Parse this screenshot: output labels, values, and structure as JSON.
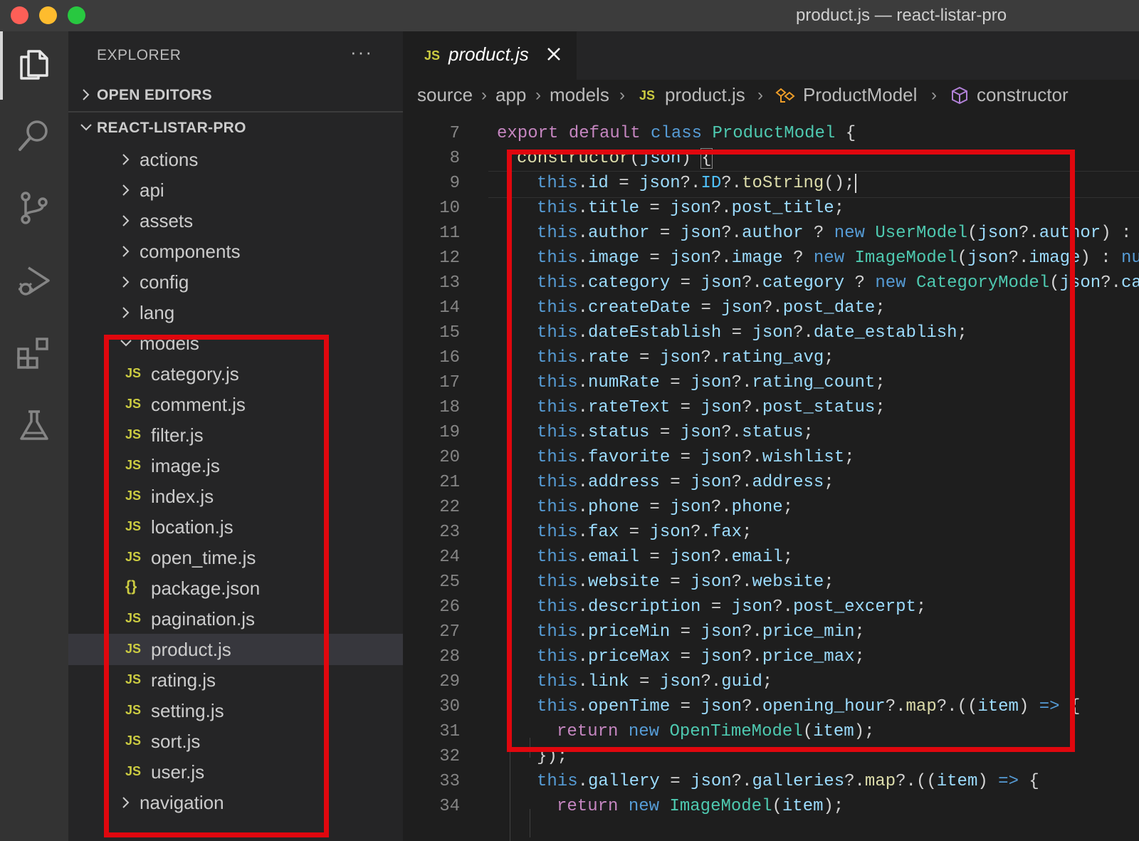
{
  "window": {
    "title": "product.js — react-listar-pro"
  },
  "activity_bar": {
    "icons": [
      "files-icon",
      "search-icon",
      "source-control-icon",
      "run-debug-icon",
      "extensions-icon",
      "testing-icon"
    ]
  },
  "sidebar": {
    "title": "EXPLORER",
    "more": "···",
    "open_editors": "OPEN EDITORS",
    "project": "REACT-LISTAR-PRO",
    "folders_top": [
      "actions",
      "api",
      "assets",
      "components",
      "config",
      "lang"
    ],
    "models_folder": "models",
    "model_files": [
      {
        "name": "category.js",
        "icon": "JS"
      },
      {
        "name": "comment.js",
        "icon": "JS"
      },
      {
        "name": "filter.js",
        "icon": "JS"
      },
      {
        "name": "image.js",
        "icon": "JS"
      },
      {
        "name": "index.js",
        "icon": "JS"
      },
      {
        "name": "location.js",
        "icon": "JS"
      },
      {
        "name": "open_time.js",
        "icon": "JS"
      },
      {
        "name": "package.json",
        "icon": "{}"
      },
      {
        "name": "pagination.js",
        "icon": "JS"
      },
      {
        "name": "product.js",
        "icon": "JS"
      },
      {
        "name": "rating.js",
        "icon": "JS"
      },
      {
        "name": "setting.js",
        "icon": "JS"
      },
      {
        "name": "sort.js",
        "icon": "JS"
      },
      {
        "name": "user.js",
        "icon": "JS"
      }
    ],
    "folders_bottom": [
      "navigation"
    ]
  },
  "tab": {
    "icon": "JS",
    "label": "product.js"
  },
  "breadcrumbs": {
    "items": [
      "source",
      "app",
      "models",
      "product.js",
      "ProductModel",
      "constructor"
    ],
    "file_icon": "JS"
  },
  "editor": {
    "line_numbers": [
      "7",
      "8",
      "9",
      "10",
      "11",
      "12",
      "13",
      "14",
      "15",
      "16",
      "17",
      "18",
      "19",
      "20",
      "21",
      "22",
      "23",
      "24",
      "25",
      "26",
      "27",
      "28",
      "29",
      "30",
      "31",
      "32",
      "33",
      "34"
    ],
    "colors": {
      "keyword": "#569cd6",
      "class": "#4ec9b0",
      "property": "#9cdcfe",
      "function": "#dcdcaa",
      "highlight": "#e0070e"
    }
  }
}
